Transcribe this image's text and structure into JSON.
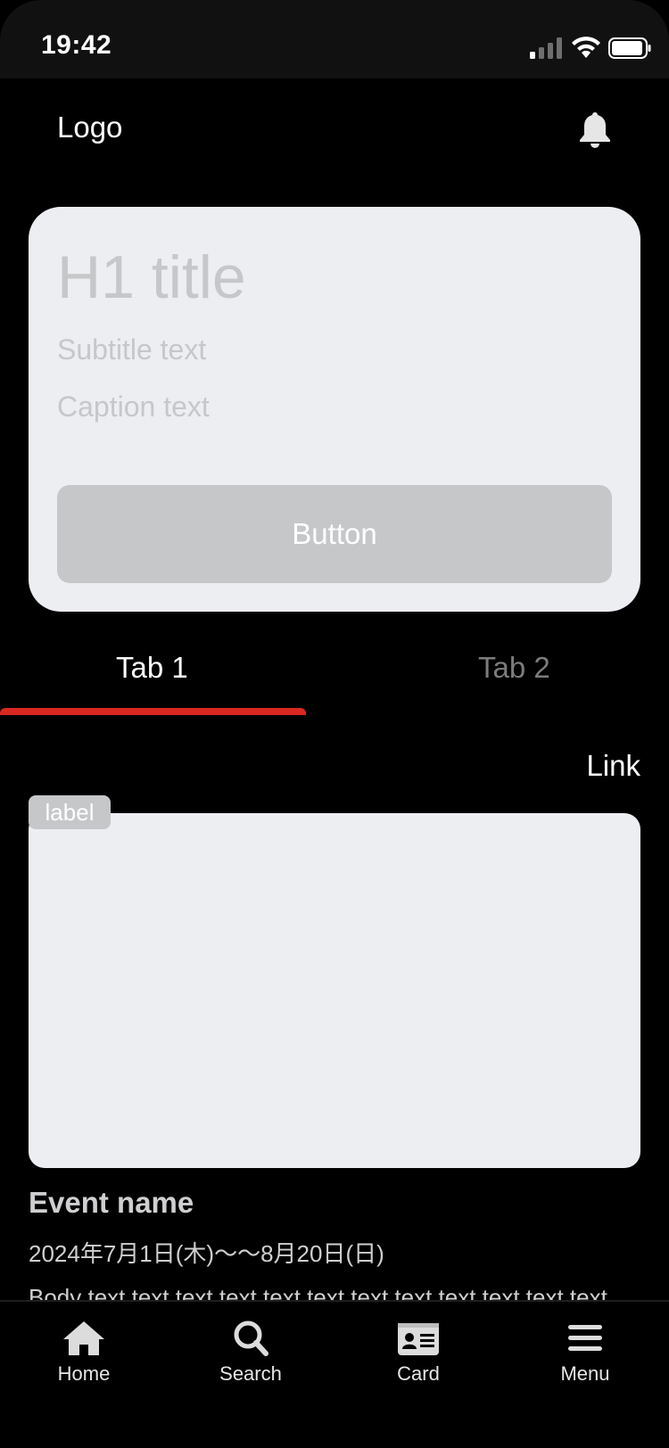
{
  "status_bar": {
    "time": "19:42"
  },
  "header": {
    "logo": "Logo"
  },
  "hero": {
    "title": "H1 title",
    "subtitle": "Subtitle text",
    "caption": "Caption text",
    "button_label": "Button"
  },
  "tabs": [
    {
      "label": "Tab 1",
      "active": true
    },
    {
      "label": "Tab 2",
      "active": false
    }
  ],
  "link_label": "Link",
  "event": {
    "badge": "label",
    "name": "Event name",
    "date": "2024年7月1日(木)〜〜8月20日(日)",
    "body": "Body text text text text text text text text text text text text"
  },
  "bottom_nav": {
    "items": [
      {
        "label": "Home",
        "icon": "home-icon"
      },
      {
        "label": "Search",
        "icon": "search-icon"
      },
      {
        "label": "Card",
        "icon": "card-icon"
      },
      {
        "label": "Menu",
        "icon": "menu-icon"
      }
    ]
  },
  "colors": {
    "accent": "#d8281f",
    "card_bg": "#edeef1",
    "placeholder_text": "#c6c7c9"
  }
}
